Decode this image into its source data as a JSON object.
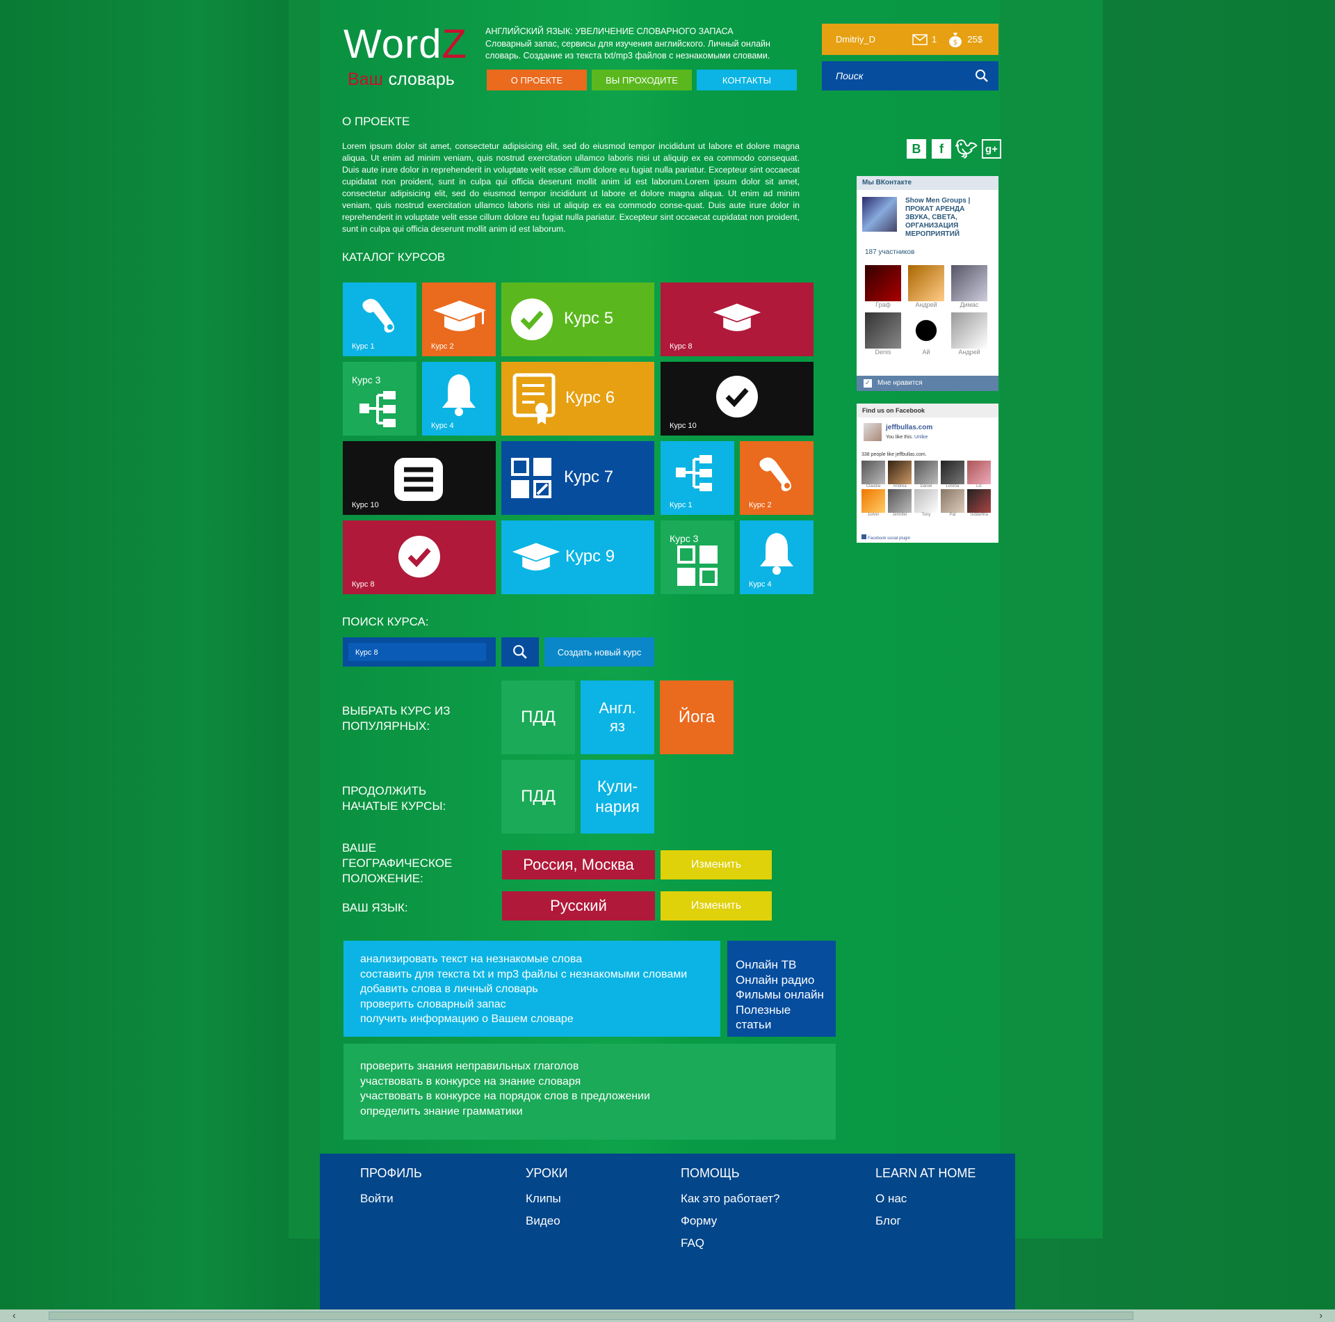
{
  "logo": {
    "word": "Word",
    "z": "Z",
    "your": "Ваш",
    "dict": "словарь"
  },
  "header": {
    "title": "АНГЛИЙСКИЙ ЯЗЫК: УВЕЛИЧЕНИЕ СЛОВАРНОГО ЗАПАСА",
    "desc": "Словарный запас, сервисы для изучения английского. Личный онлайн словарь. Создание из текста txt/mp3 файлов с незнакомыми словами."
  },
  "nav": [
    {
      "label": "О ПРОЕКТЕ",
      "color": "#ea6a1e"
    },
    {
      "label": "ВЫ ПРОХОДИТЕ",
      "color": "#5ab81e"
    },
    {
      "label": "КОНТАКТЫ",
      "color": "#0bb4e4"
    }
  ],
  "user": {
    "name": "Dmitriy_D",
    "messages": "1",
    "money": "25$"
  },
  "search_top": {
    "placeholder": "Поиск"
  },
  "about": {
    "title": "О ПРОЕКТЕ",
    "text": "Lorem ipsum dolor sit amet, consectetur adipisicing elit, sed do eiusmod tempor incididunt ut labore et dolore magna aliqua. Ut enim ad minim veniam, quis nostrud exercitation ullamco laboris nisi ut aliquip ex ea commodo consequat. Duis aute irure dolor in reprehenderit in voluptate velit esse cillum dolore eu fugiat nulla pariatur. Excepteur sint occaecat cupidatat non proident, sunt in culpa qui officia deserunt mollit anim id est laborum.Lorem ipsum dolor sit amet, consectetur adipisicing elit, sed do eiusmod tempor incididunt ut labore et dolore magna aliqua. Ut enim ad minim veniam, quis nostrud exercitation ullamco laboris nisi ut aliquip ex ea commodo conse-quat. Duis aute irure dolor in reprehenderit in voluptate velit esse cillum dolore eu fugiat nulla pariatur. Excepteur sint occaecat cupidatat non proident, sunt in culpa qui officia deserunt mollit anim id est laborum."
  },
  "catalog": {
    "title": "КАТАЛОГ КУРСОВ",
    "tiles": {
      "t1": "Курс 1",
      "t2": "Курс 2",
      "t5": "Курс 5",
      "t8": "Курс 8",
      "t3": "Курс 3",
      "t4": "Курс 4",
      "t6": "Курс 6",
      "t10": "Курс 10",
      "t10b": "Курс 10",
      "t7": "Курс 7",
      "t1b": "Курс 1",
      "t2b": "Курс 2",
      "t8b": "Курс 8",
      "t9": "Курс 9",
      "t3b": "Курс 3",
      "t4b": "Курс 4"
    },
    "colors": {
      "blue": "#0bb4e4",
      "orange": "#ea6a1e",
      "green": "#5ab81e",
      "red": "#b0193a",
      "teal": "#1aaa58",
      "amber": "#e6a012",
      "black": "#111111",
      "navy": "#064d9e"
    }
  },
  "course_search": {
    "title": "ПОИСК КУРСА:",
    "value": "Курс 8",
    "create": "Создать новый курс"
  },
  "popular": {
    "label": "ВЫБРАТЬ КУРС ИЗ ПОПУЛЯРНЫХ:",
    "items": [
      "ПДД",
      "Англ. яз",
      "Йога"
    ]
  },
  "continue": {
    "label": "ПРОДОЛЖИТЬ НАЧАТЫЕ КУРСЫ:",
    "items": [
      "ПДД",
      "Кули­нария"
    ]
  },
  "geo": {
    "label": "ВАШЕ ГЕОГРАФИЧЕСКОЕ ПОЛОЖЕНИЕ:",
    "value": "Россия, Москва",
    "change": "Изменить"
  },
  "lang": {
    "label": "ВАШ  ЯЗЫК:",
    "value": "Русский",
    "change": "Изменить"
  },
  "features1": [
    "анализировать текст на незнакомые слова",
    "составить для текста txt и mp3 файлы с незнакомыми словами",
    "добавить слова в личный словарь",
    "проверить словарный запас",
    "получить информацию о Вашем словаре"
  ],
  "features_side": [
    "Онлайн ТВ",
    "Онлайн радио",
    "Фильмы онлайн",
    "Полезные статьи"
  ],
  "features2": [
    "проверить знания неправильных глаголов",
    "участвовать в конкурсе на знание словаря",
    "участвовать в конкурсе на порядок слов в предложении",
    "определить знание грамматики"
  ],
  "vk": {
    "header": "Мы ВКонтакте",
    "group": "Show Men Groups | ПРОКАТ АРЕНДА ЗВУКА, СВЕТА, ОРГАНИЗАЦИЯ МЕРОПРИЯТИЙ",
    "members": "187 участников",
    "people": [
      "Граф",
      "Андрей",
      "Димас",
      "Denis",
      "Ай",
      "Андрей"
    ],
    "like": "Мне нравится"
  },
  "facebook": {
    "header": "Find us on Facebook",
    "page": "jeffbullas.com",
    "you_like": "You like this.",
    "unlike": "Unlike",
    "count": "338 people like jeffbullas.com.",
    "people": [
      "Claudia",
      "Andrea",
      "Daniel",
      "Lorena",
      "Liz",
      "JoAnn",
      "Jennifer",
      "Tony",
      "Pat",
      "Siddartha"
    ],
    "plugin": "Facebook social plugin"
  },
  "footer": [
    {
      "title": "ПРОФИЛЬ",
      "links": [
        "Войти"
      ]
    },
    {
      "title": "УРОКИ",
      "links": [
        "Клипы",
        "Видео"
      ]
    },
    {
      "title": "ПОМОЩЬ",
      "links": [
        "Как это работает?",
        "Форму",
        "FAQ"
      ]
    },
    {
      "title": "LEARN AT HOME",
      "links": [
        "О нас",
        "Блог"
      ]
    }
  ]
}
